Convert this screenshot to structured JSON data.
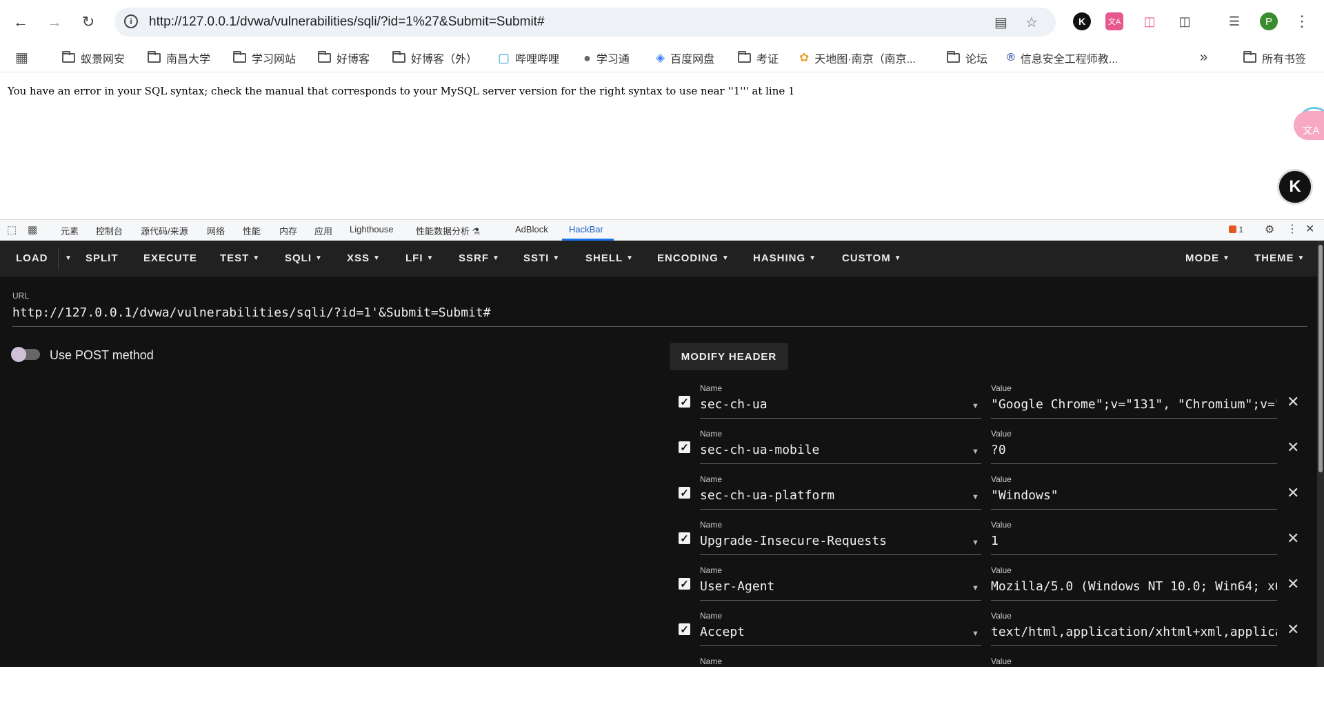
{
  "browser": {
    "url": "http://127.0.0.1/dvwa/vulnerabilities/sqli/?id=1%27&Submit=Submit#",
    "profile_initial": "P",
    "ext_k": "K",
    "ext_translate": "文A"
  },
  "bookmarks": {
    "items": [
      "蚁景网安",
      "南昌大学",
      "学习网站",
      "好博客",
      "好博客（外）",
      "哔哩哔哩",
      "学习通",
      "百度网盘",
      "考证",
      "天地图·南京（南京...",
      "论坛",
      "信息安全工程师教..."
    ],
    "more": "»",
    "all": "所有书签"
  },
  "page": {
    "error": "You have an error in your SQL syntax; check the manual that corresponds to your MySQL server version for the right syntax to use near ''1''' at line 1",
    "float_k": "K",
    "float_translate": "文A"
  },
  "devtools": {
    "tabs": [
      "元素",
      "控制台",
      "源代码/来源",
      "网络",
      "性能",
      "内存",
      "应用",
      "Lighthouse",
      "性能数据分析 ⚗",
      "AdBlock",
      "HackBar"
    ],
    "issues": "1"
  },
  "hackbar": {
    "menu": {
      "load": "LOAD",
      "split": "SPLIT",
      "execute": "EXECUTE",
      "test": "TEST",
      "sqli": "SQLI",
      "xss": "XSS",
      "lfi": "LFI",
      "ssrf": "SSRF",
      "ssti": "SSTI",
      "shell": "SHELL",
      "encoding": "ENCODING",
      "hashing": "HASHING",
      "custom": "CUSTOM",
      "mode": "MODE",
      "theme": "THEME"
    },
    "url_label": "URL",
    "url_value": "http://127.0.0.1/dvwa/vulnerabilities/sqli/?id=1'&Submit=Submit#",
    "post_label": "Use POST method",
    "modify_header": "MODIFY HEADER",
    "name_label": "Name",
    "value_label": "Value",
    "headers": [
      {
        "name": "sec-ch-ua",
        "value": "\"Google Chrome\";v=\"131\", \"Chromium\";v=\""
      },
      {
        "name": "sec-ch-ua-mobile",
        "value": "?0"
      },
      {
        "name": "sec-ch-ua-platform",
        "value": "\"Windows\""
      },
      {
        "name": "Upgrade-Insecure-Requests",
        "value": "1"
      },
      {
        "name": "User-Agent",
        "value": "Mozilla/5.0 (Windows NT 10.0; Win64; x6"
      },
      {
        "name": "Accept",
        "value": "text/html,application/xhtml+xml,applica"
      },
      {
        "name": "",
        "value": ""
      }
    ]
  }
}
